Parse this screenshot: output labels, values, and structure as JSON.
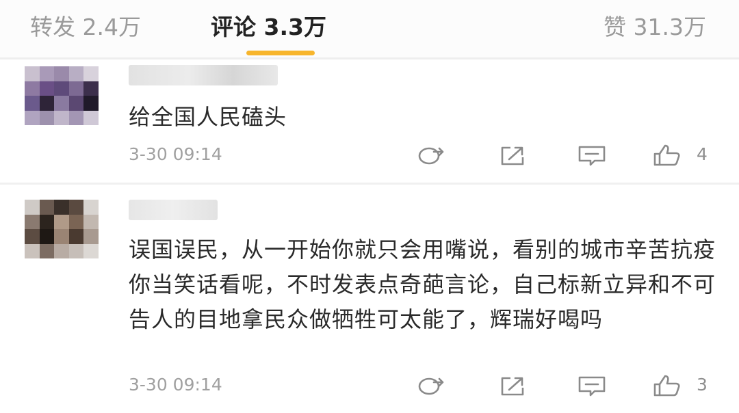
{
  "tabs": {
    "repost": "转发 2.4万",
    "comment": "评论 3.3万",
    "like": "赞 31.3万",
    "active": "comment",
    "indicator_color": "#f7b52c"
  },
  "comments": [
    {
      "text": "给全国人民磕头",
      "time": "3-30 09:14",
      "likes": "4"
    },
    {
      "text": "误国误民，从一开始你就只会用嘴说，看别的城市辛苦抗疫你当笑话看呢，不时发表点奇葩言论，自己标新立异和不可告人的目地拿民众做牺牲可太能了，辉瑞好喝吗",
      "time": "3-30 09:14",
      "likes": "3"
    }
  ],
  "icons": {
    "forward": "forward-icon",
    "share": "share-icon",
    "comment": "comment-icon",
    "like": "thumbs-up-icon"
  }
}
